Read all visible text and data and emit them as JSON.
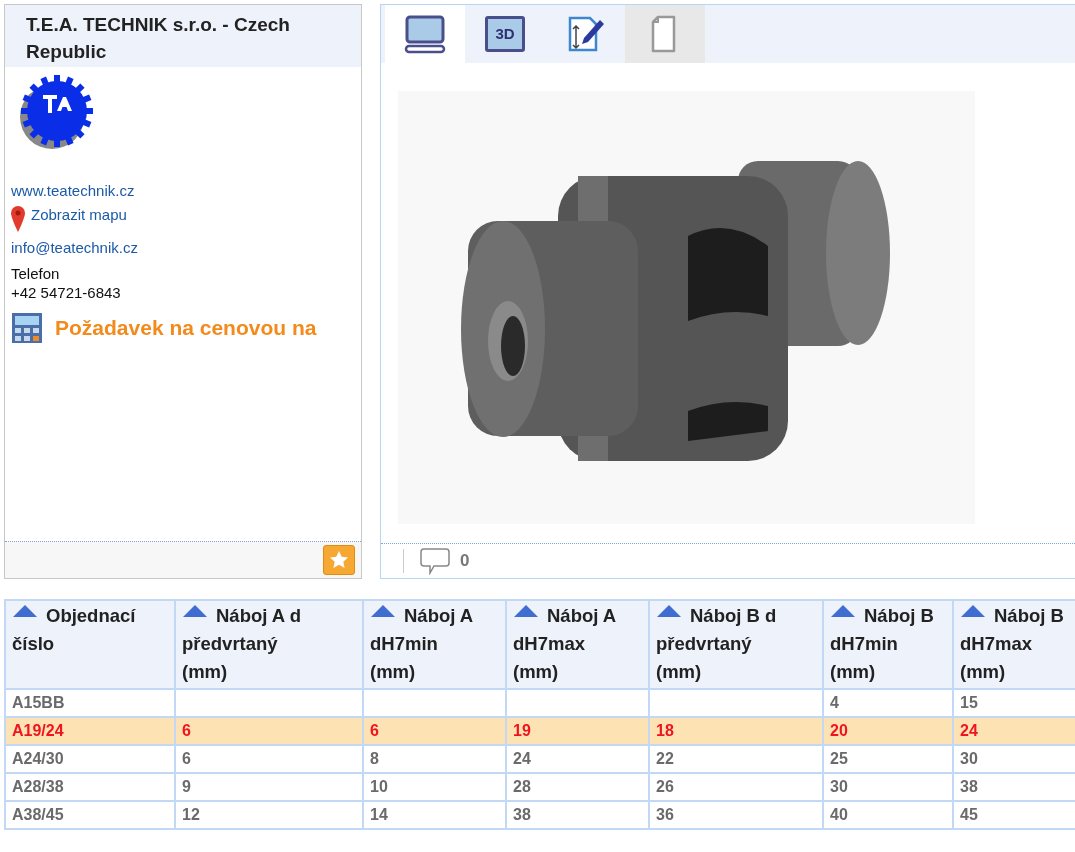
{
  "company": {
    "name": "T.E.A. TECHNIK s.r.o. - Czech Republic",
    "website": "www.teatechnik.cz",
    "map_link": "Zobrazit mapu",
    "email": "info@teatechnik.cz",
    "phone_label": "Telefon",
    "phone": "+42 54721-6843",
    "quote_link": "Požadavek na cenovou na"
  },
  "viewer": {
    "tabs": [
      {
        "kind": "screen",
        "selected": true,
        "disabled": false
      },
      {
        "kind": "threed",
        "label": "3D",
        "selected": false,
        "disabled": false
      },
      {
        "kind": "drawing",
        "selected": false,
        "disabled": false
      },
      {
        "kind": "document",
        "selected": false,
        "disabled": true
      }
    ],
    "comment_count": "0"
  },
  "table": {
    "columns": [
      {
        "lines": [
          "Objednací",
          "číslo"
        ]
      },
      {
        "lines": [
          "Náboj A d",
          "předvrtaný",
          "(mm)"
        ]
      },
      {
        "lines": [
          "Náboj A",
          "dH7min",
          "(mm)"
        ]
      },
      {
        "lines": [
          "Náboj A",
          "dH7max",
          "(mm)"
        ]
      },
      {
        "lines": [
          "Náboj B d",
          "předvrtaný",
          "(mm)"
        ]
      },
      {
        "lines": [
          "Náboj B",
          "dH7min",
          "(mm)"
        ]
      },
      {
        "lines": [
          "Náboj B",
          "dH7max",
          "(mm)"
        ]
      }
    ],
    "rows": [
      {
        "selected": false,
        "cells": [
          "A15BB",
          "",
          "",
          "",
          "",
          "4",
          "15"
        ]
      },
      {
        "selected": true,
        "cells": [
          "A19/24",
          "6",
          "6",
          "19",
          "18",
          "20",
          "24"
        ]
      },
      {
        "selected": false,
        "cells": [
          "A24/30",
          "6",
          "8",
          "24",
          "22",
          "25",
          "30"
        ]
      },
      {
        "selected": false,
        "cells": [
          "A28/38",
          "9",
          "10",
          "28",
          "26",
          "30",
          "38"
        ]
      },
      {
        "selected": false,
        "cells": [
          "A38/45",
          "12",
          "14",
          "38",
          "36",
          "40",
          "45"
        ]
      }
    ]
  }
}
